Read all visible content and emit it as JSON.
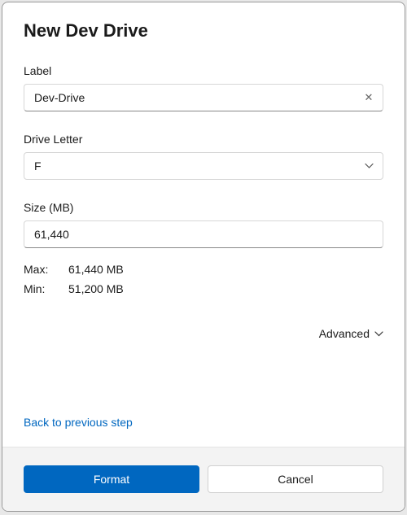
{
  "title": "New Dev Drive",
  "label": {
    "field_label": "Label",
    "value": "Dev-Drive"
  },
  "drive_letter": {
    "field_label": "Drive Letter",
    "value": "F"
  },
  "size": {
    "field_label": "Size (MB)",
    "value": "61,440"
  },
  "limits": {
    "max_label": "Max:",
    "max_value": "61,440 MB",
    "min_label": "Min:",
    "min_value": "51,200 MB"
  },
  "advanced_label": "Advanced",
  "back_link": "Back to previous step",
  "buttons": {
    "format": "Format",
    "cancel": "Cancel"
  }
}
